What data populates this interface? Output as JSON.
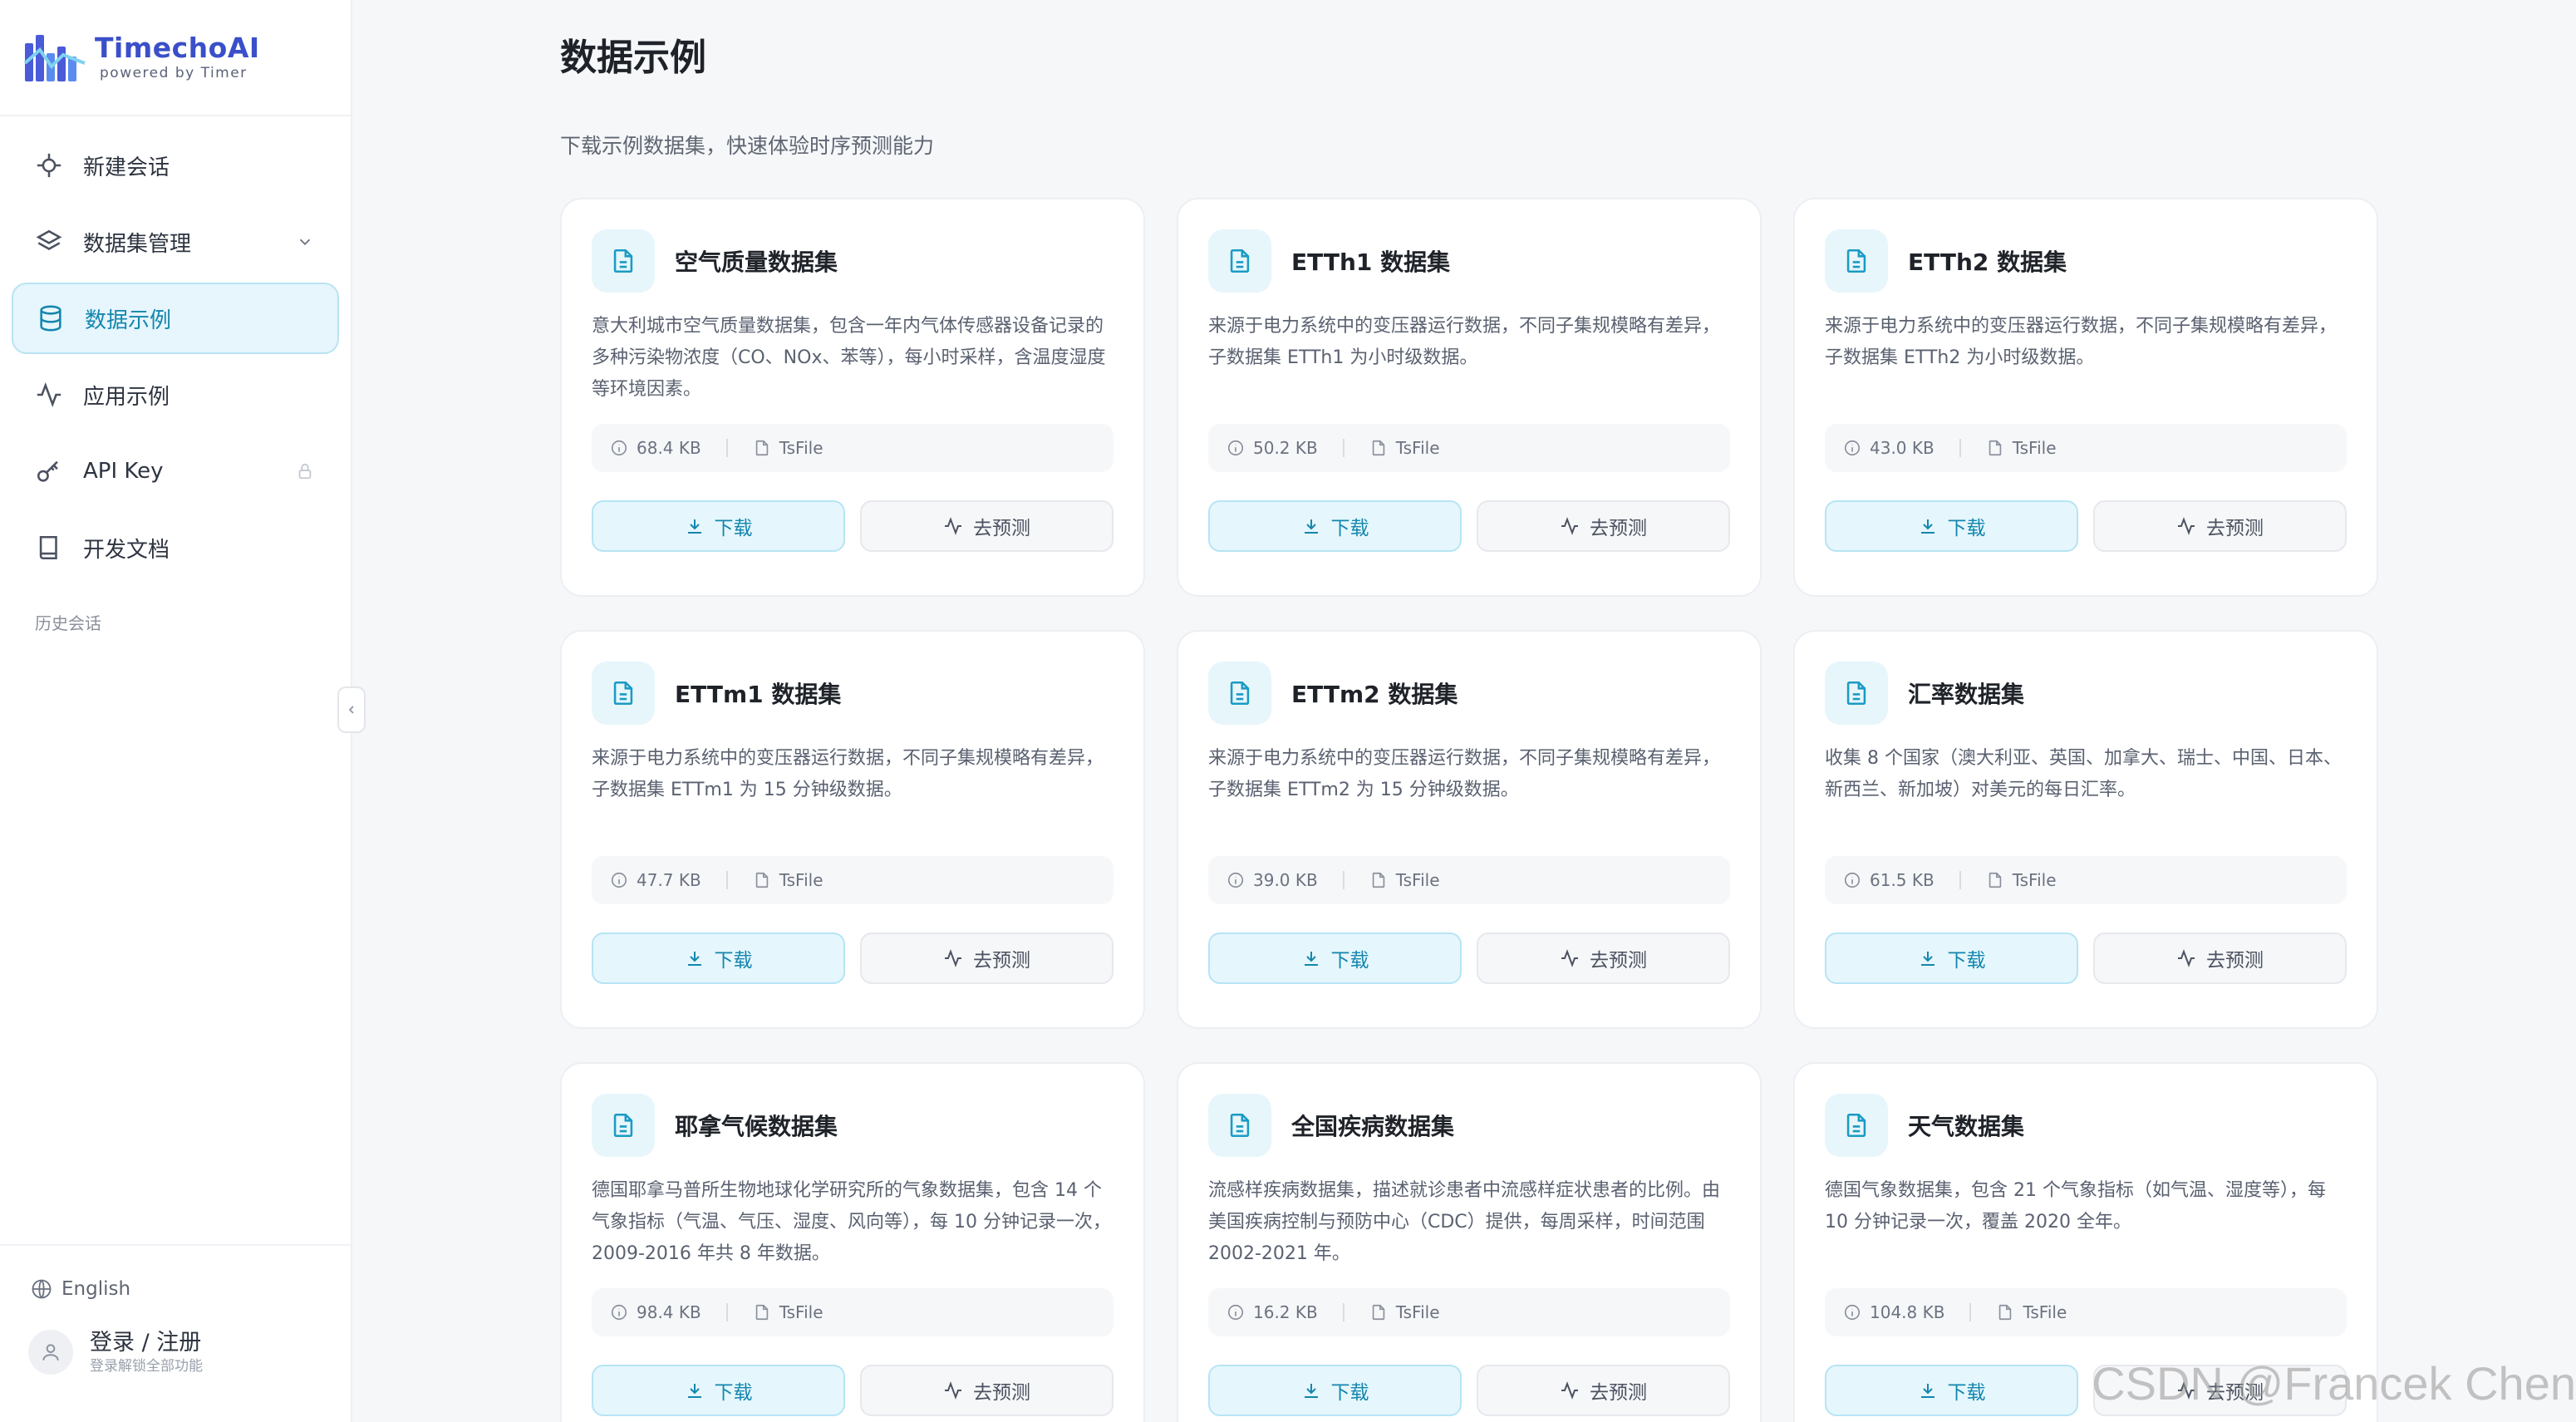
{
  "brand": {
    "name": "TimechoAI",
    "sub": "powered by Timer"
  },
  "nav": {
    "items": [
      {
        "label": "新建会话"
      },
      {
        "label": "数据集管理"
      },
      {
        "label": "数据示例"
      },
      {
        "label": "应用示例"
      },
      {
        "label": "API Key"
      },
      {
        "label": "开发文档"
      }
    ],
    "history_label": "历史会话"
  },
  "footer": {
    "language": "English",
    "login_title": "登录 / 注册",
    "login_sub": "登录解锁全部功能"
  },
  "page": {
    "title": "数据示例",
    "subtitle": "下载示例数据集，快速体验时序预测能力"
  },
  "cards": [
    {
      "title": "空气质量数据集",
      "desc": "意大利城市空气质量数据集，包含一年内气体传感器设备记录的多种污染物浓度（CO、NOx、苯等），每小时采样，含温度湿度等环境因素。",
      "size": "68.4 KB",
      "format": "TsFile",
      "download": "下载",
      "predict": "去预测"
    },
    {
      "title": "ETTh1 数据集",
      "desc": "来源于电力系统中的变压器运行数据，不同子集规模略有差异，子数据集 ETTh1 为小时级数据。",
      "size": "50.2 KB",
      "format": "TsFile",
      "download": "下载",
      "predict": "去预测"
    },
    {
      "title": "ETTh2 数据集",
      "desc": "来源于电力系统中的变压器运行数据，不同子集规模略有差异，子数据集 ETTh2 为小时级数据。",
      "size": "43.0 KB",
      "format": "TsFile",
      "download": "下载",
      "predict": "去预测"
    },
    {
      "title": "ETTm1 数据集",
      "desc": "来源于电力系统中的变压器运行数据，不同子集规模略有差异，子数据集 ETTm1 为 15 分钟级数据。",
      "size": "47.7 KB",
      "format": "TsFile",
      "download": "下载",
      "predict": "去预测"
    },
    {
      "title": "ETTm2 数据集",
      "desc": "来源于电力系统中的变压器运行数据，不同子集规模略有差异，子数据集 ETTm2 为 15 分钟级数据。",
      "size": "39.0 KB",
      "format": "TsFile",
      "download": "下载",
      "predict": "去预测"
    },
    {
      "title": "汇率数据集",
      "desc": "收集 8 个国家（澳大利亚、英国、加拿大、瑞士、中国、日本、新西兰、新加坡）对美元的每日汇率。",
      "size": "61.5 KB",
      "format": "TsFile",
      "download": "下载",
      "predict": "去预测"
    },
    {
      "title": "耶拿气候数据集",
      "desc": "德国耶拿马普所生物地球化学研究所的气象数据集，包含 14 个气象指标（气温、气压、湿度、风向等），每 10 分钟记录一次，2009-2016 年共 8 年数据。",
      "size": "98.4 KB",
      "format": "TsFile",
      "download": "下载",
      "predict": "去预测"
    },
    {
      "title": "全国疾病数据集",
      "desc": "流感样疾病数据集，描述就诊患者中流感样症状患者的比例。由美国疾病控制与预防中心（CDC）提供，每周采样，时间范围 2002-2021 年。",
      "size": "16.2 KB",
      "format": "TsFile",
      "download": "下载",
      "predict": "去预测"
    },
    {
      "title": "天气数据集",
      "desc": "德国气象数据集，包含 21 个气象指标（如气温、湿度等），每 10 分钟记录一次，覆盖 2020 全年。",
      "size": "104.8 KB",
      "format": "TsFile",
      "download": "下载",
      "predict": "去预测"
    }
  ],
  "watermark": "CSDN @Francek Chen",
  "colors": {
    "accent": "#1486ad",
    "brand": "#3a4fc9",
    "active_bg": "#e6f6fc"
  }
}
